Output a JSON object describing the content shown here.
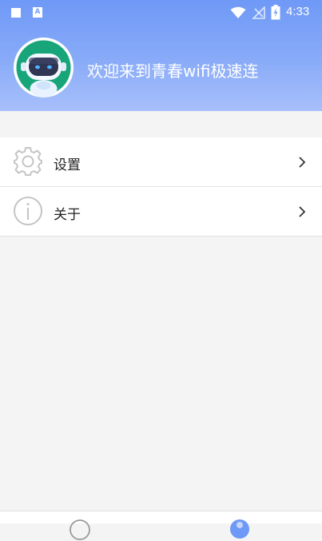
{
  "status_bar": {
    "time": "4:33",
    "icons": [
      "notification-square-icon",
      "a-badge-icon",
      "wifi-icon",
      "signal-icon",
      "battery-charging-icon"
    ],
    "a_badge": "A"
  },
  "header": {
    "welcome_text": "欢迎来到青春wifi极速连",
    "avatar": "robot-avatar",
    "gradient_top": "#6f99f7",
    "gradient_bottom": "#a8c0fa"
  },
  "menu": {
    "items": [
      {
        "label": "设置",
        "icon": "gear-icon"
      },
      {
        "label": "关于",
        "icon": "info-icon"
      }
    ]
  },
  "tab_bar": {
    "icons": [
      "tab-home-icon",
      "tab-profile-icon"
    ],
    "active_color": "#6f99f7"
  }
}
